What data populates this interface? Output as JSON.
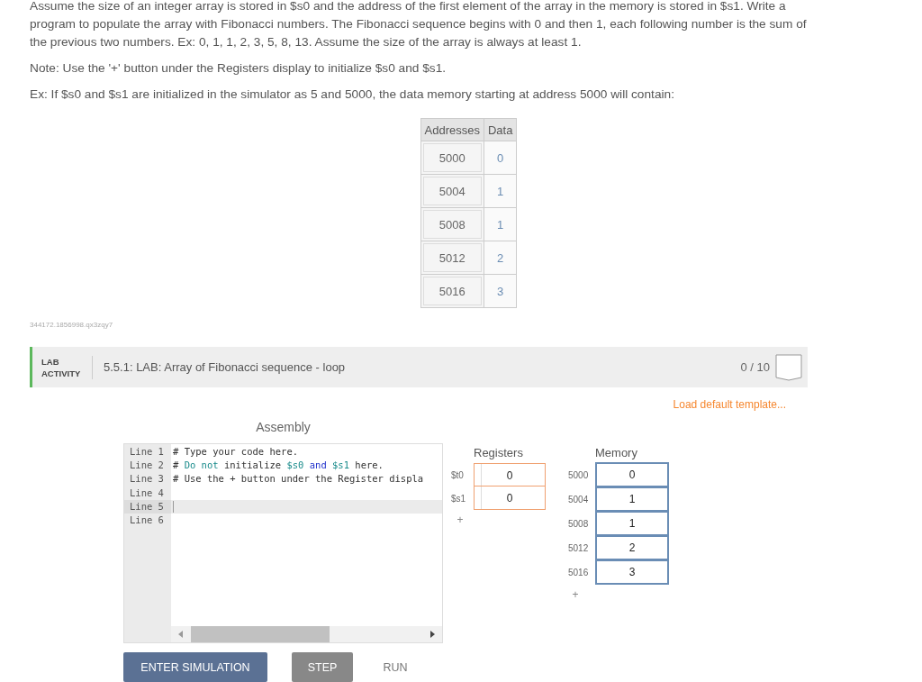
{
  "intro": {
    "paragraphs": [
      "Assume the size of an integer array is stored in $s0 and the address of the first element of the array in the memory is stored in $s1. Write a program to populate the array with Fibonacci numbers. The Fibonacci sequence begins with 0 and then 1, each following number is the sum of the previous two numbers. Ex: 0, 1, 1, 2, 3, 5, 8, 13. Assume the size of the array is always at least 1.",
      "Note: Use the '+' button under the Registers display to initialize $s0 and $s1.",
      "Ex: If $s0 and $s1 are initialized in the simulator as 5 and 5000, the data memory starting at address 5000 will contain:"
    ]
  },
  "example_table": {
    "columns": [
      "Addresses",
      "Data"
    ],
    "rows": [
      {
        "address": "5000",
        "data": "0"
      },
      {
        "address": "5004",
        "data": "1"
      },
      {
        "address": "5008",
        "data": "1"
      },
      {
        "address": "5012",
        "data": "2"
      },
      {
        "address": "5016",
        "data": "3"
      }
    ]
  },
  "activity_id": "344172.1856998.qx3zqy7",
  "lab": {
    "tag": "LAB ACTIVITY",
    "title": "5.5.1: LAB: Array of Fibonacci sequence - loop",
    "score": "0 / 10",
    "load_template": "Load default template...",
    "editor": {
      "title": "Assembly",
      "lines": [
        {
          "label": "Line 1",
          "current": false,
          "tokens": [
            {
              "text": "# Type your code here.",
              "kind": "plain"
            }
          ]
        },
        {
          "label": "Line 2",
          "current": false,
          "tokens": [
            {
              "text": "# ",
              "kind": "plain"
            },
            {
              "text": "Do not",
              "kind": "keyword"
            },
            {
              "text": " initialize ",
              "kind": "plain"
            },
            {
              "text": "$s0",
              "kind": "register"
            },
            {
              "text": " and ",
              "kind": "operator"
            },
            {
              "text": "$s1",
              "kind": "register"
            },
            {
              "text": " here.",
              "kind": "plain"
            }
          ]
        },
        {
          "label": "Line 3",
          "current": false,
          "tokens": [
            {
              "text": "# Use the + button under the Register displa",
              "kind": "plain"
            }
          ]
        },
        {
          "label": "Line 4",
          "current": false
        },
        {
          "label": "Line 5",
          "current": true
        },
        {
          "label": "Line 6",
          "current": false
        }
      ]
    },
    "registers": {
      "title": "Registers",
      "items": [
        {
          "name": "$t0",
          "value": "0"
        },
        {
          "name": "$s1",
          "value": "0"
        }
      ],
      "add": "+"
    },
    "memory": {
      "title": "Memory",
      "items": [
        {
          "address": "5000",
          "value": "0"
        },
        {
          "address": "5004",
          "value": "1"
        },
        {
          "address": "5008",
          "value": "1"
        },
        {
          "address": "5012",
          "value": "2"
        },
        {
          "address": "5016",
          "value": "3"
        }
      ],
      "add": "+"
    },
    "buttons": [
      {
        "label": "ENTER SIMULATION",
        "kind": "primary"
      },
      {
        "label": "STEP",
        "kind": "secondary"
      },
      {
        "label": "RUN",
        "kind": "flat"
      }
    ]
  }
}
